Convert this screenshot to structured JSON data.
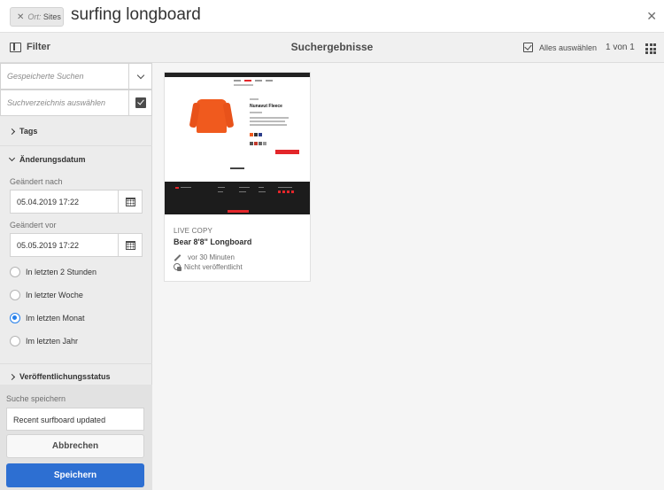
{
  "search": {
    "tag_prefix": "Ort:",
    "tag_value": "Sites",
    "tag_remove": "✕",
    "query": "surfing longboard",
    "close": "✕"
  },
  "actionbar": {
    "filter_label": "Filter",
    "title": "Suchergebnisse",
    "select_all": "Alles auswählen",
    "count": "1 von 1"
  },
  "rail": {
    "saved_searches_placeholder": "Gespeicherte Suchen",
    "search_dir_placeholder": "Suchverzeichnis auswählen",
    "tags_label": "Tags",
    "modified_label": "Änderungsdatum",
    "modified_after_label": "Geändert nach",
    "modified_after_value": "05.04.2019 17:22",
    "modified_before_label": "Geändert vor",
    "modified_before_value": "05.05.2019 17:22",
    "radios": [
      {
        "label": "In letzten 2 Stunden",
        "checked": false
      },
      {
        "label": "In letzter Woche",
        "checked": false
      },
      {
        "label": "Im letzten Monat",
        "checked": true
      },
      {
        "label": "Im letzten Jahr",
        "checked": false
      }
    ],
    "publication_label": "Veröffentlichungsstatus",
    "save_search_label": "Suche speichern",
    "save_search_value": "Recent surfboard updated",
    "cancel_label": "Abbrechen",
    "save_label": "Speichern"
  },
  "card": {
    "type": "LIVE COPY",
    "title": "Bear 8'8\" Longboard",
    "modified": "vor 30 Minuten",
    "status": "Nicht veröffentlicht",
    "thumb_product_title": "Nunavut Fleece"
  },
  "colors": {
    "accent": "#2d6fd2",
    "radio_on": "#2680eb",
    "thumb_red": "#e3262a",
    "jacket": "#f05a1e"
  }
}
